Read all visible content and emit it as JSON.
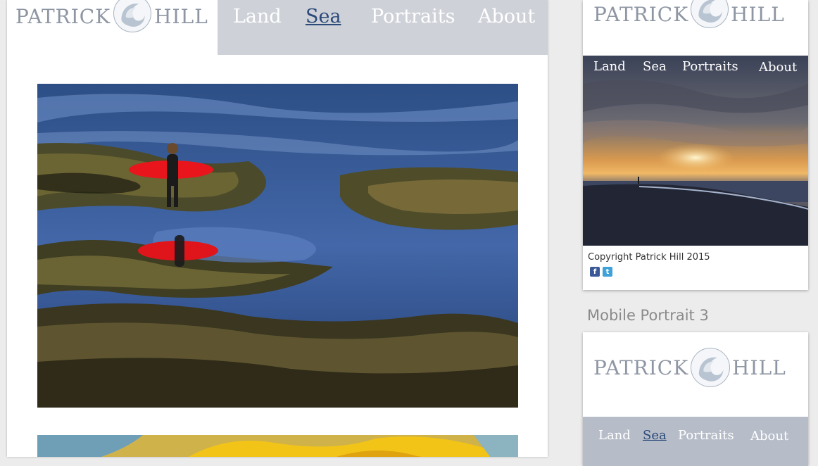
{
  "brand": {
    "first": "PATRICK",
    "last": "HILL"
  },
  "main": {
    "nav": [
      {
        "label": "Land",
        "active": false
      },
      {
        "label": "Sea",
        "active": true
      },
      {
        "label": "Portraits",
        "active": false
      },
      {
        "label": "About",
        "active": false
      }
    ]
  },
  "mobile_card": {
    "nav": [
      {
        "label": "Land"
      },
      {
        "label": "Sea"
      },
      {
        "label": "Portraits"
      },
      {
        "label": "About"
      }
    ],
    "copyright": "Copyright Patrick Hill 2015",
    "social": [
      {
        "icon": "facebook-icon",
        "glyph": "f"
      },
      {
        "icon": "twitter-icon",
        "glyph": "t"
      }
    ]
  },
  "section_label": "Mobile Portrait 3",
  "mobile_portrait": {
    "nav": [
      {
        "label": "Land",
        "active": false
      },
      {
        "label": "Sea",
        "active": true
      },
      {
        "label": "Portraits",
        "active": false
      },
      {
        "label": "About",
        "active": false
      }
    ]
  },
  "colors": {
    "nav_bg": "#ced2d8",
    "active_link": "#2c4a7a",
    "logo_text": "#8e96a3"
  }
}
